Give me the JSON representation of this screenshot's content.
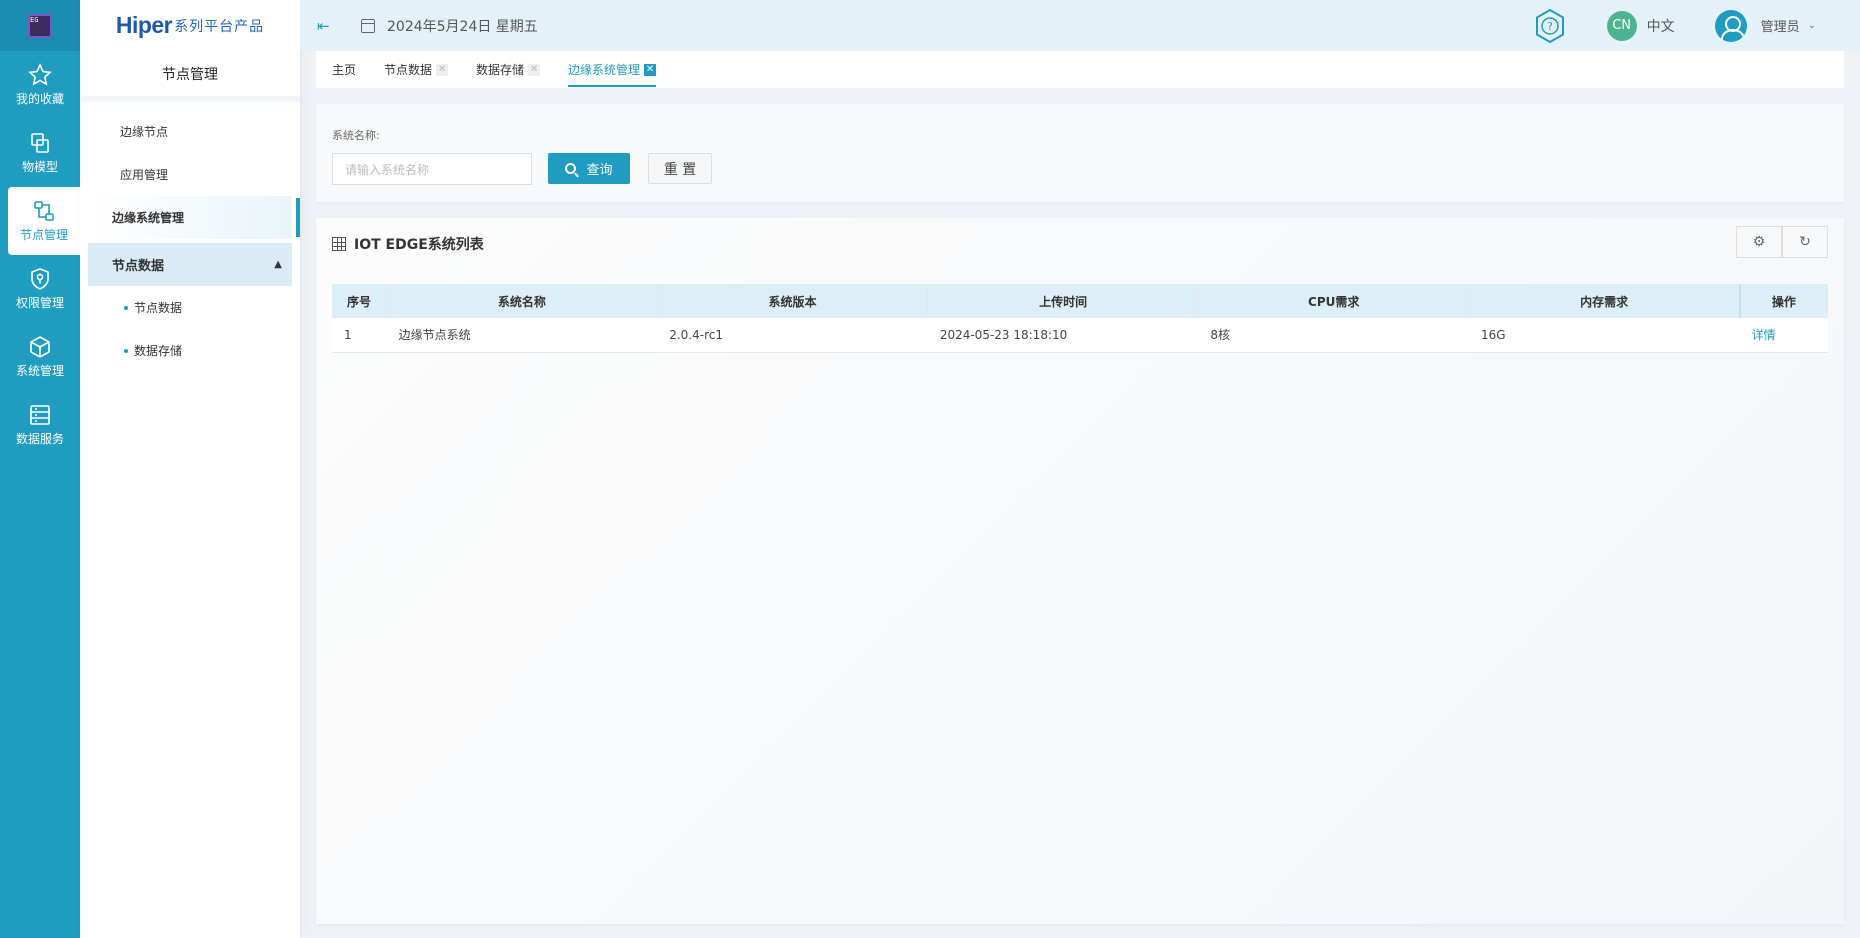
{
  "rail": {
    "logo": "EG",
    "items": [
      {
        "label": "我的收藏",
        "icon": "star-icon"
      },
      {
        "label": "物模型",
        "icon": "model-icon"
      },
      {
        "label": "节点管理",
        "icon": "node-icon",
        "active": true
      },
      {
        "label": "权限管理",
        "icon": "shield-icon"
      },
      {
        "label": "系统管理",
        "icon": "cube-icon"
      },
      {
        "label": "数据服务",
        "icon": "server-icon"
      }
    ]
  },
  "brand": {
    "name": "Hiper",
    "tagline": "系列平台产品"
  },
  "sidebar": {
    "title": "节点管理",
    "items": [
      {
        "label": "边缘节点"
      },
      {
        "label": "应用管理"
      },
      {
        "label": "边缘系统管理",
        "active": true
      },
      {
        "label": "节点数据",
        "group": true
      },
      {
        "label": "节点数据",
        "sub": true
      },
      {
        "label": "数据存储",
        "sub": true
      }
    ]
  },
  "topbar": {
    "date": "2024年5月24日 星期五",
    "lang_badge": "CN",
    "lang": "中文",
    "user": "管理员"
  },
  "tabs": [
    {
      "label": "主页"
    },
    {
      "label": "节点数据",
      "closable": true
    },
    {
      "label": "数据存储",
      "closable": true
    },
    {
      "label": "边缘系统管理",
      "closable": true,
      "active": true
    }
  ],
  "search": {
    "label": "系统名称:",
    "placeholder": "请输入系统名称",
    "query_btn": "查询",
    "reset_btn": "重 置"
  },
  "table": {
    "title": "IOT EDGE系统列表",
    "columns": [
      "序号",
      "系统名称",
      "系统版本",
      "上传时间",
      "CPU需求",
      "内存需求",
      "操作"
    ],
    "rows": [
      [
        "1",
        "边缘节点系统",
        "2.0.4-rc1",
        "2024-05-23 18:18:10",
        "8核",
        "16G",
        "详情"
      ]
    ]
  },
  "colors": {
    "primary": "#1f9cc0",
    "rail": "#1f9cc0"
  }
}
